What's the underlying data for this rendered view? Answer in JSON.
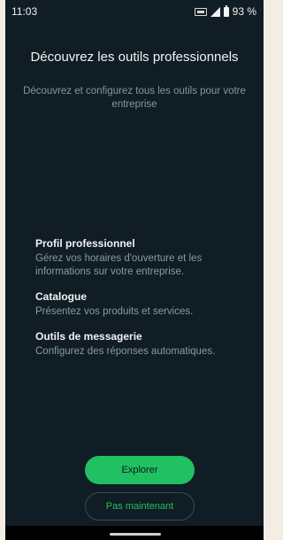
{
  "status_bar": {
    "time": "11:03",
    "battery": "93 %",
    "icons": [
      "volte-icon",
      "signal-icon",
      "battery-icon"
    ]
  },
  "header": {
    "title": "Découvrez les outils professionnels",
    "subtitle": "Découvrez et configurez tous les outils pour votre entreprise"
  },
  "features": [
    {
      "title": "Profil professionnel",
      "description": "Gérez vos horaires d'ouverture et les informations sur votre entreprise."
    },
    {
      "title": "Catalogue",
      "description": "Présentez vos produits et services."
    },
    {
      "title": "Outils de messagerie",
      "description": "Configurez des réponses automatiques."
    }
  ],
  "actions": {
    "primary_label": "Explorer",
    "secondary_label": "Pas maintenant"
  },
  "colors": {
    "background": "#101d24",
    "accent": "#21c063",
    "muted_text": "#8696a0"
  }
}
